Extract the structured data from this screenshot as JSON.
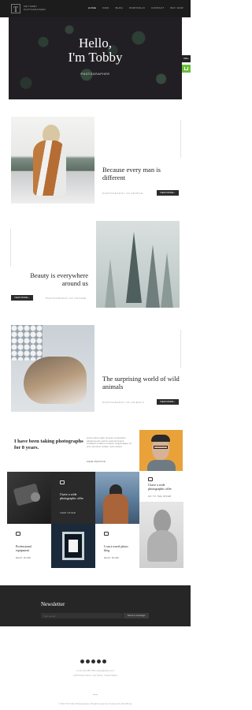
{
  "header": {
    "logo": "T",
    "brand_line1": "MR TOBBY",
    "brand_line2": "PHOTOGRAPHER",
    "nav": [
      "HOME",
      "INFO",
      "BLOG",
      "PORTFOLIO",
      "CONTACT",
      "BUY NOW"
    ]
  },
  "hero": {
    "title_line1": "Hello,",
    "title_line2": "I'm Tobby",
    "subtitle": "PHOTOGRAPHER",
    "side_tab": "600+"
  },
  "features": [
    {
      "title": "Because every man is different",
      "caption": "PHOTOGRAPHY OF PEOPLE",
      "button": "VIEW MORE"
    },
    {
      "title": "Beauty is everywhere around us",
      "caption": "PHOTOGRAPHY OF NATURE",
      "button": "VIEW MORE"
    },
    {
      "title": "The surprising world of wild animals",
      "caption": "PHOTOGRAPHY OF ANIMALS",
      "button": "VIEW MORE"
    }
  ],
  "about": {
    "heading": "I have been taking photographs for 8 years.",
    "text": "Lorem ipsum dolor sit amet, consectetur adipiscing elit, sed do eiusmod tempor incididunt ut labore et dolore magna aliqua. Ut enim ad minim veniam, quis nostrud",
    "link": "VIEW PHOTOS"
  },
  "grid": {
    "c1_title": "I have a wide photographic offer",
    "c1_link": "VIEW OFFER",
    "c2_title": "I have a wide photographic offer",
    "c2_link": "GO TO THE OFFER",
    "c3_title": "Professional equipment",
    "c3_link": "READ MORE",
    "c4_title": "I run a travel photo blog",
    "c4_link": "READ MORE"
  },
  "newsletter": {
    "title": "Newsletter",
    "placeholder": "Your e-mail",
    "button": "Send a message"
  },
  "footer": {
    "contact": "+1 (0) 123 456 789  |  tobby@photo.com",
    "address": "1234 Street Name, City Name, United States",
    "copyright": "© 2017 Mr Tobby Photographer. All rights reserved. Powered by WordPress"
  },
  "colors": {
    "accent": "#6bbf3a",
    "dark": "#262626"
  }
}
